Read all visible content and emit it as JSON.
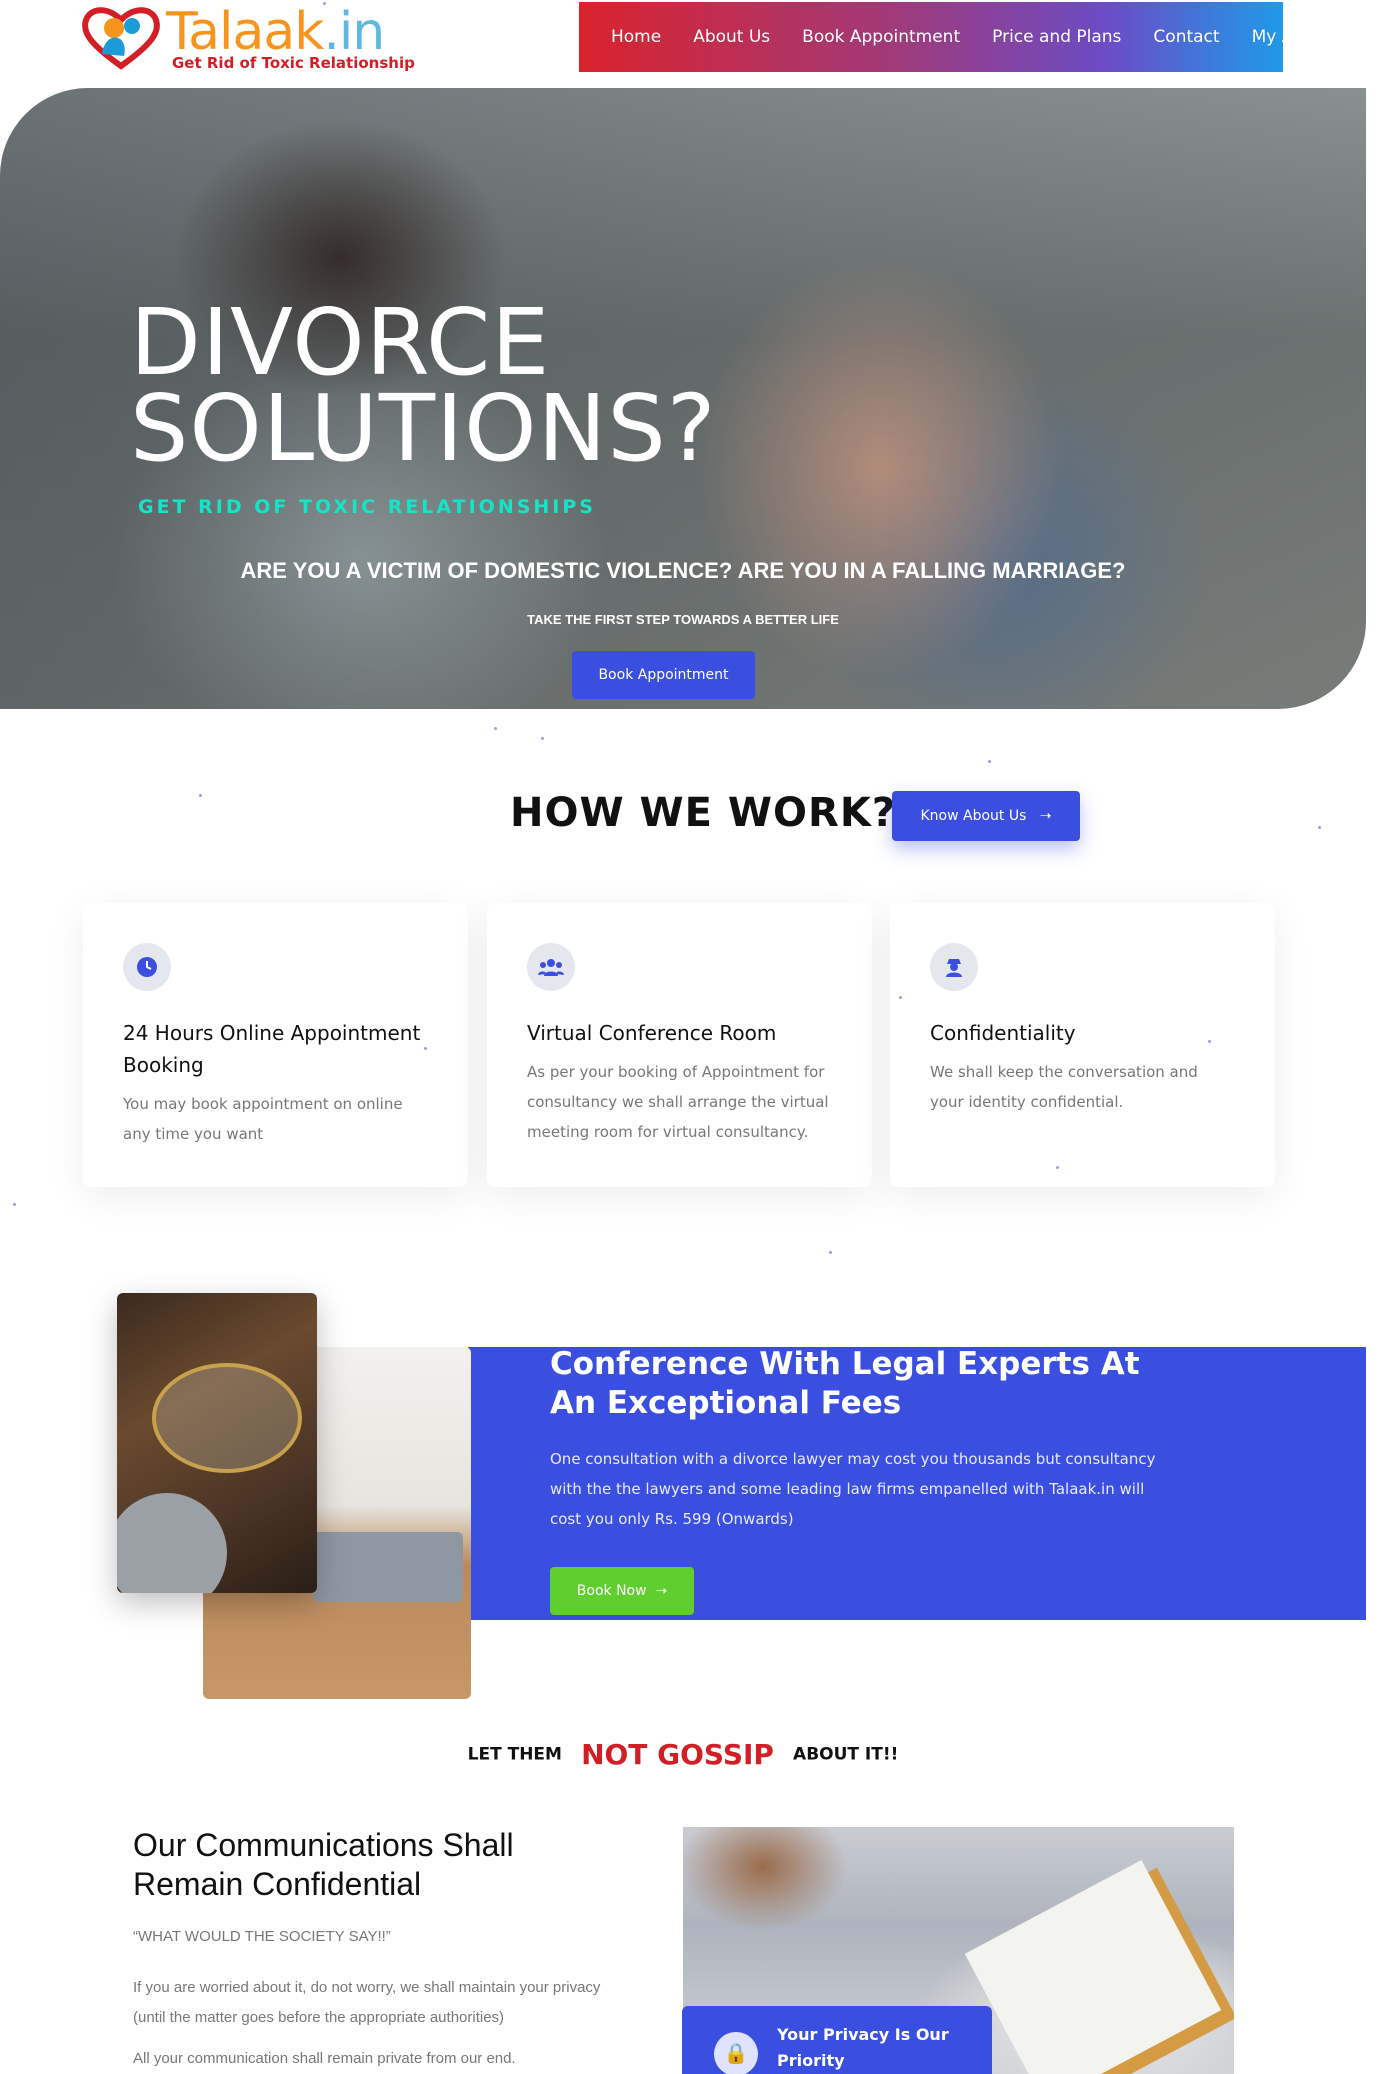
{
  "header": {
    "logo_text": "Talaak",
    "logo_suffix": ".in",
    "logo_tagline": "Get Rid of Toxic Relationship",
    "nav": [
      "Home",
      "About Us",
      "Book Appointment",
      "Price and Plans",
      "Contact",
      "My Account"
    ]
  },
  "hero": {
    "title": "DIVORCE\nSOLUTIONS?",
    "tagline": "GET RID OF TOXIC RELATIONSHIPS",
    "question": "ARE YOU A VICTIM OF DOMESTIC VIOLENCE? ARE YOU IN A FALLING MARRIAGE?",
    "subtext": "TAKE THE FIRST STEP TOWARDS A BETTER LIFE",
    "button": "Book Appointment"
  },
  "how_we_work": {
    "title": "HOW WE WORK?",
    "button": "Know About Us",
    "button_icon": "arrow-right-icon",
    "cards": [
      {
        "icon": "clock-icon",
        "title": "24 Hours Online Appointment Booking",
        "text": "You may book appointment on online any time you want"
      },
      {
        "icon": "users-icon",
        "title": "Virtual Conference Room",
        "text": "As per your booking of Appointment for consultancy we shall arrange the virtual meeting room for virtual consultancy."
      },
      {
        "icon": "user-secret-icon",
        "title": "Confidentiality",
        "text": "We shall keep the conversation and your identity confidential."
      }
    ]
  },
  "conference": {
    "title": "Conference With Legal Experts At An Exceptional Fees",
    "text": "One consultation with a divorce lawyer may cost you thousands but consultancy with the the lawyers and some leading law firms empanelled with Talaak.in will cost you only Rs. 599 (Onwards)",
    "button": "Book Now",
    "button_icon": "arrow-right-icon"
  },
  "gossip": {
    "before": "LET THEM",
    "highlight": "NOT GOSSIP",
    "after": "ABOUT IT!!"
  },
  "confidential": {
    "title": "Our Communications Shall Remain Confidential",
    "quote": "“WHAT WOULD THE SOCIETY SAY!!”",
    "para1": "If you are worried about it, do not worry, we shall maintain your privacy (until the matter goes before the appropriate authorities)",
    "para2": "All your communication shall remain private from our end.",
    "privacy_label": "Your Privacy Is Our Priority",
    "privacy_icon": "user-lock-icon"
  },
  "colors": {
    "accent": "#3a4fe0",
    "brand_red": "#d21f26",
    "brand_orange": "#f7941d",
    "cta_green": "#5fcf2f",
    "hero_tagline": "#14e5c9"
  }
}
